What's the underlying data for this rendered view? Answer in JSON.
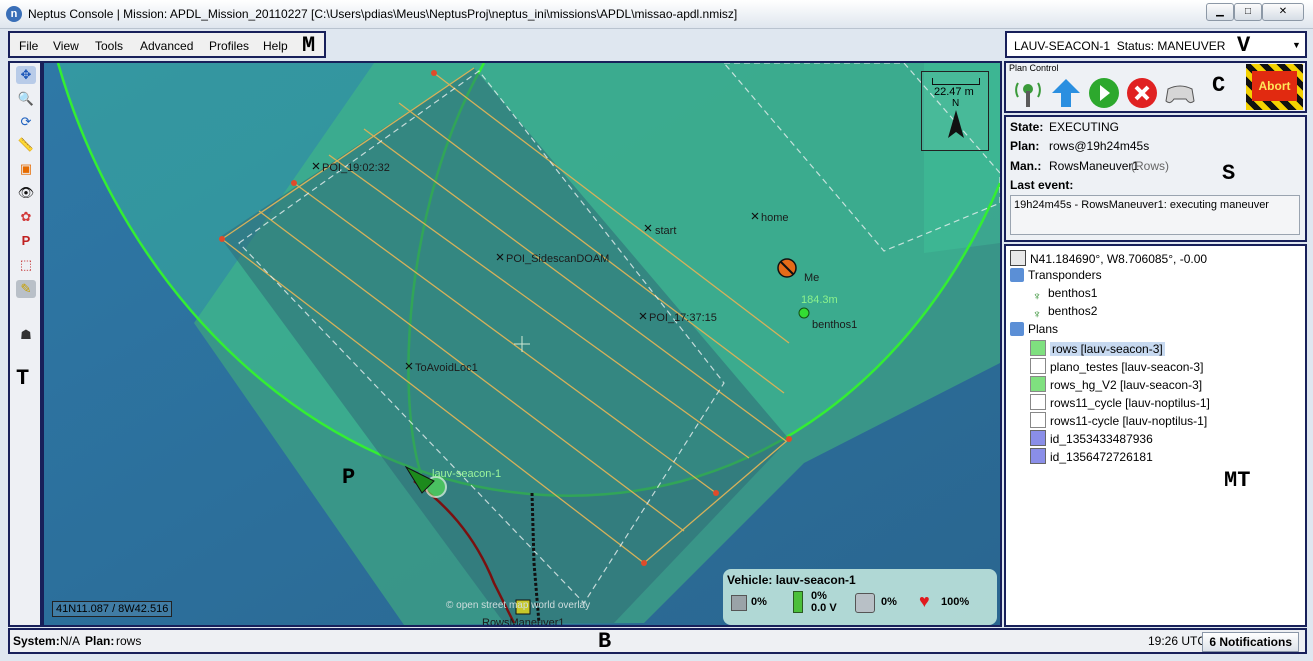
{
  "window": {
    "title": "Neptus Console | Mission: APDL_Mission_20110227 [C:\\Users\\pdias\\Meus\\NeptusProj\\neptus_ini\\missions\\APDL\\missao-apdl.nmisz]",
    "app_icon_glyph": "n"
  },
  "menu": {
    "items": [
      "File",
      "View",
      "Tools",
      "Advanced",
      "Profiles",
      "Help"
    ]
  },
  "box_labels": {
    "menu": "M",
    "vehicle": "V",
    "control": "C",
    "state": "S",
    "toolbar": "T",
    "map": "P",
    "tree": "MT",
    "bottom": "B"
  },
  "vehicle_selector": {
    "value": "LAUV-SEACON-1  Status: MANEUVER"
  },
  "plan_control": {
    "title": "Plan Control",
    "abort_label": "Abort",
    "icons": [
      "beacon-icon",
      "send-plan-arrow-icon",
      "start-plan-icon",
      "stop-plan-icon",
      "teleoperation-gamepad-icon"
    ]
  },
  "state_panel": {
    "state_label": "State:",
    "state_value": "EXECUTING",
    "plan_label": "Plan:",
    "plan_value": "rows@19h24m45s",
    "man_label": "Man.:",
    "man_value": "RowsManeuver1",
    "man_type": "(Rows)",
    "last_event_label": "Last event:",
    "last_event_value": "19h24m45s - RowsManeuver1: executing maneuver"
  },
  "mission_tree": {
    "home": "N41.184690°, W8.706085°, -0.00",
    "transponders_label": "Transponders",
    "transponders": [
      "benthos1",
      "benthos2"
    ],
    "plans_label": "Plans",
    "plans": [
      {
        "label": "rows [lauv-seacon-3]",
        "selected": true,
        "kind": "green"
      },
      {
        "label": "plano_testes [lauv-seacon-3]",
        "selected": false,
        "kind": "white"
      },
      {
        "label": "rows_hg_V2 [lauv-seacon-3]",
        "selected": false,
        "kind": "green"
      },
      {
        "label": "rows11_cycle [lauv-noptilus-1]",
        "selected": false,
        "kind": "white"
      },
      {
        "label": "rows11-cycle [lauv-noptilus-1]",
        "selected": false,
        "kind": "white"
      },
      {
        "label": "id_1353433487936",
        "selected": false,
        "kind": "blue"
      },
      {
        "label": "id_1356472726181",
        "selected": false,
        "kind": "blue"
      }
    ]
  },
  "map": {
    "scale": "22.47 m",
    "north": "N",
    "coords": "41N11.087 / 8W42.516",
    "attribution": "© open street map world overlay",
    "labels": {
      "poi1": "POI_19:02:32",
      "poi2": "POI_SidescanDOAM",
      "poi3": "POI_17:37:15",
      "start": "start",
      "home": "home",
      "avoid": "ToAvoidLoc1",
      "me": "Me",
      "distance": "184.3m",
      "benthos": "benthos1",
      "vehicle": "lauv-seacon-1",
      "maneuver": "RowsManeuver1"
    },
    "vehicle_info": {
      "title": "Vehicle: lauv-seacon-1",
      "cpu": "0%",
      "battery": "0%",
      "voltage": "0.0 V",
      "storage": "0%",
      "health": "100%"
    },
    "colors": {
      "water": "#2c6f9b",
      "land": "#3f9b8c",
      "coverage": "#3fc39a",
      "safety_circle": "#33ee33",
      "plan_lines": "#d6b15a"
    }
  },
  "statusbar": {
    "system_label": "System:",
    "system_value": "N/A",
    "plan_label": "Plan:",
    "plan_value": "rows",
    "time": "19:26 UTC",
    "notifications": "6 Notifications"
  }
}
